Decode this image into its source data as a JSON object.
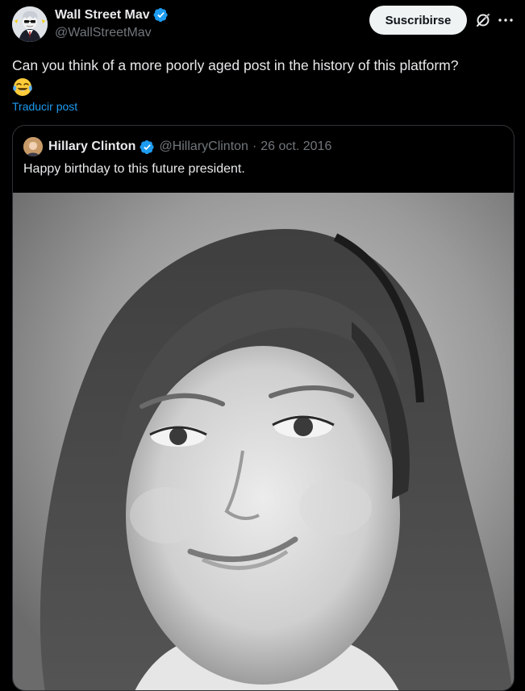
{
  "author": {
    "display_name": "Wall Street Mav",
    "handle": "@WallStreetMav"
  },
  "actions": {
    "subscribe_label": "Suscribirse",
    "grok_icon": "grok-icon",
    "more_icon": "more-horizontal-icon"
  },
  "post": {
    "text": "Can you think of a more poorly aged post in the history of this platform?",
    "emoji": "face-with-tears-of-joy-emoji",
    "translate_label": "Traducir post"
  },
  "quoted": {
    "display_name": "Hillary Clinton",
    "handle": "@HillaryClinton",
    "separator": "·",
    "date": "26 oct. 2016",
    "text": "Happy birthday to this future president.",
    "media": "black-and-white-portrait-photo"
  },
  "colors": {
    "background": "#000000",
    "text_primary": "#e7e9ea",
    "text_secondary": "#71767b",
    "accent": "#1d9bf0",
    "border": "#2f3336",
    "subscribe_bg": "#eff3f4"
  }
}
